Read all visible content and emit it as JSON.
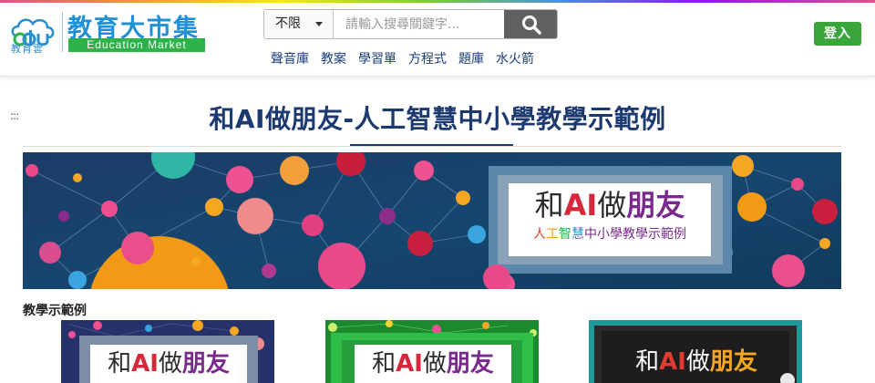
{
  "header": {
    "logo": {
      "mark": "edu",
      "sub": "教育雲",
      "title": "教育大市集",
      "english": "Education Market"
    },
    "search": {
      "scope_value": "不限",
      "placeholder": "請輸入搜尋關鍵字...",
      "button_icon": "search-icon"
    },
    "nav": [
      "聲音庫",
      "教案",
      "學習單",
      "方程式",
      "題庫",
      "水火箭"
    ],
    "login_label": "登入"
  },
  "page": {
    "drag_handle": ":::",
    "title": "和AI做朋友-人工智慧中小學教學示範例",
    "banner": {
      "brand_prefix": "和",
      "brand_ai": "AI",
      "brand_do": "做",
      "brand_friend": "朋友",
      "sub_ren": "人",
      "sub_gong": "工",
      "sub_zhi": "智",
      "sub_hui": "慧",
      "sub_rest": "中小學教學示範例"
    },
    "section_label": "教學示範例",
    "cards": [
      {
        "he": "和",
        "ai": "AI",
        "zuo": "做",
        "friend": "朋友"
      },
      {
        "he": "和",
        "ai": "AI",
        "zuo": "做",
        "friend": "朋友"
      },
      {
        "he": "和",
        "ai": "AI",
        "zuo": "做",
        "friend": "朋友"
      }
    ]
  },
  "colors": {
    "brand_blue": "#1f90d6",
    "english_bar_green": "#2db24a",
    "login_green": "#3aa53a",
    "title_navy": "#1c3a70",
    "nav_link": "#1a3e78",
    "ai_red": "#d8263a",
    "friend_purple": "#7a2a8c"
  }
}
